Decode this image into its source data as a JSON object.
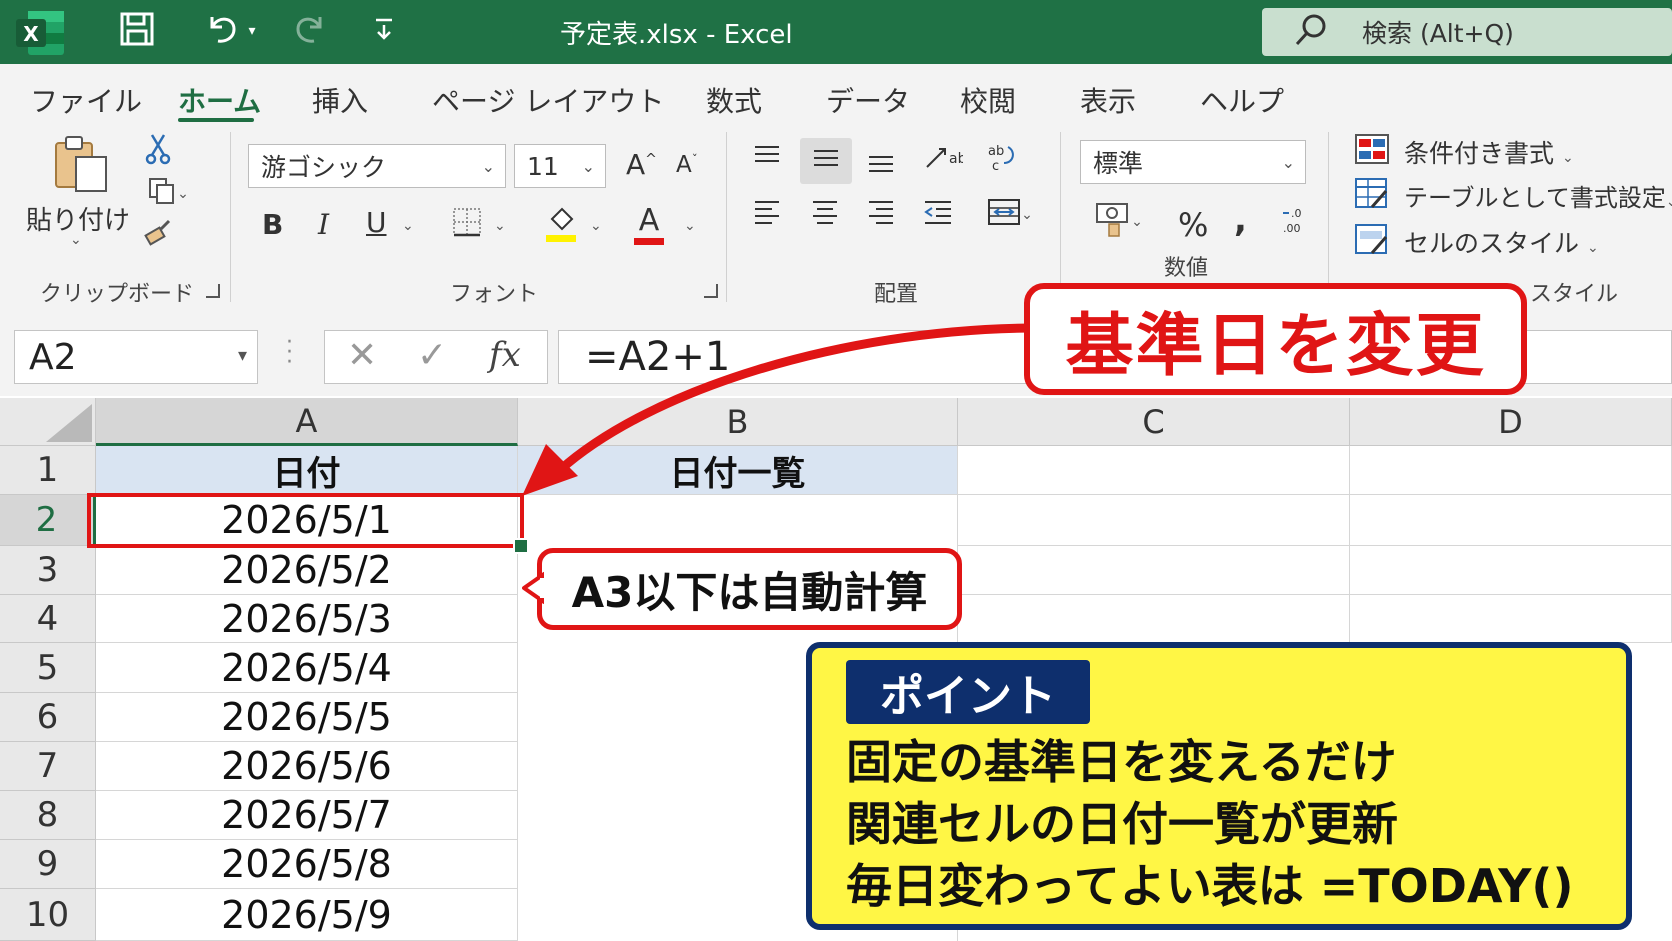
{
  "titlebar": {
    "doc_title": "予定表.xlsx  -  Excel",
    "search_label": "検索 (Alt+Q)",
    "logo_letter": "X"
  },
  "tabs": [
    "ファイル",
    "ホーム",
    "挿入",
    "ページ レイアウト",
    "数式",
    "データ",
    "校閲",
    "表示",
    "ヘルプ"
  ],
  "active_tab": "ホーム",
  "ribbon": {
    "clipboard": {
      "paste_label": "貼り付け",
      "group_label": "クリップボード"
    },
    "font": {
      "font_name": "游ゴシック",
      "font_size": "11",
      "bold": "B",
      "italic": "I",
      "underline": "U",
      "font_color_letter": "A",
      "grow": "A",
      "shrink": "A",
      "group_label": "フォント"
    },
    "alignment": {
      "group_label": "配置"
    },
    "number": {
      "format": "標準",
      "percent": "%",
      "comma": ",",
      "group_label": "数値"
    },
    "styles": {
      "conditional": "条件付き書式",
      "as_table": "テーブルとして書式設定",
      "cell_styles": "セルのスタイル",
      "group_label": "スタイル"
    }
  },
  "formula_bar": {
    "name_box": "A2",
    "formula": "=A2+1",
    "fx": "fx"
  },
  "grid": {
    "columns": [
      "A",
      "B",
      "C",
      "D"
    ],
    "rows": [
      "1",
      "2",
      "3",
      "4",
      "5",
      "6",
      "7",
      "8",
      "9",
      "10"
    ],
    "header_a": "日付",
    "header_b": "日付一覧",
    "dates": [
      "2026/5/1",
      "2026/5/2",
      "2026/5/3",
      "2026/5/4",
      "2026/5/5",
      "2026/5/6",
      "2026/5/7",
      "2026/5/8",
      "2026/5/9"
    ]
  },
  "callouts": {
    "main": "基準日を変更",
    "sub": "A3以下は自動計算",
    "point_badge": "ポイント",
    "point_lines": [
      "固定の基準日を変えるだけ",
      "関連セルの日付一覧が更新",
      "毎日変わってよい表は =TODAY()"
    ]
  },
  "colors": {
    "excel_green": "#1f7145",
    "callout_red": "#e01515",
    "point_yellow": "#fff645",
    "point_navy": "#0e2f6d"
  }
}
